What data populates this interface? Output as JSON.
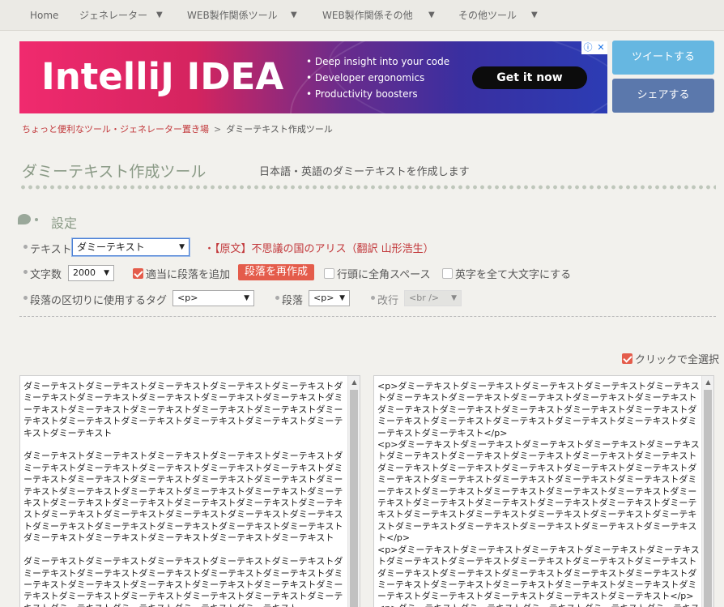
{
  "nav": {
    "items": [
      {
        "label": "Home"
      },
      {
        "label": "ジェネレーター",
        "arrow": "▼"
      },
      {
        "label": "WEB製作関係ツール",
        "arrow": "▼"
      },
      {
        "label": "WEB製作関係その他",
        "arrow": "▼"
      },
      {
        "label": "その他ツール",
        "arrow": "▼"
      }
    ]
  },
  "ad": {
    "logo": "IntelliJ IDEA",
    "bullets": [
      "• Deep insight into your code",
      "• Developer ergonomics",
      "• Productivity boosters"
    ],
    "cta": "Get it now",
    "info_icon": "ⓘ",
    "close_icon": "✕"
  },
  "social": {
    "tweet": "ツイートする",
    "share": "シェアする"
  },
  "breadcrumb": {
    "home": "ちょっと便利なツール・ジェネレーター置き場",
    "sep": ">",
    "current": "ダミーテキスト作成ツール"
  },
  "page": {
    "title": "ダミーテキスト作成ツール",
    "subtitle": "日本語・英語のダミーテキストを作成します"
  },
  "settings": {
    "title": "設定",
    "text_label": "テキスト",
    "text_select": "ダミーテキスト",
    "source_link": "・【原文】不思議の国のアリス（翻訳 山形浩生）",
    "count_label": "文字数",
    "count_select": "2000",
    "para_label": "適当に段落を追加",
    "regen_button": "段落を再作成",
    "indent_label": "行頭に全角スペース",
    "upper_label": "英字を全て大文字にする",
    "sep_tag_label": "段落の区切りに使用するタグ",
    "sep_tag_select": "<p>",
    "paragraph_label": "段落",
    "paragraph_select": "<p>",
    "linebreak_label": "改行",
    "linebreak_select": "<br />",
    "dropdown_arrow": "▼"
  },
  "output": {
    "select_all_label": "クリックで全選択",
    "left_text": "ダミーテキストダミーテキストダミーテキストダミーテキストダミーテキストダミーテキストダミーテキストダミーテキストダミーテキストダミーテキストダミーテキストダミーテキストダミーテキストダミーテキストダミーテキストダミーテキストダミーテキストダミーテキストダミーテキストダミーテキストダミーテキストダミーテキスト\n\nダミーテキストダミーテキストダミーテキストダミーテキストダミーテキストダミーテキストダミーテキストダミーテキストダミーテキストダミーテキストダミーテキストダミーテキストダミーテキストダミーテキストダミーテキストダミーテキストダミーテキストダミーテキストダミーテキストダミーテキストダミーテキストダミーテキストダミーテキストダミーテキストダミーテキストダミーテキストダミーテキストダミーテキストダミーテキストダミーテキストダミーテキストダミーテキストダミーテキストダミーテキストダミーテキストダミーテキストダミーテキストダミーテキストダミーテキストダミーテキストダミーテキスト\n\nダミーテキストダミーテキストダミーテキストダミーテキストダミーテキストダミーテキストダミーテキストダミーテキストダミーテキストダミーテキストダミーテキストダミーテキストダミーテキストダミーテキストダミーテキストダミーテキストダミーテキストダミーテキストダミーテキストダミーテキストダミーテキストダミーテキストダミーテキストダミーテキストダミーテキスト",
    "right_text": "<p>ダミーテキストダミーテキストダミーテキストダミーテキストダミーテキストダミーテキストダミーテキストダミーテキストダミーテキストダミーテキストダミーテキストダミーテキストダミーテキストダミーテキストダミーテキストダミーテキストダミーテキストダミーテキストダミーテキストダミーテキストダミーテキストダミーテキスト</p>\n<p>ダミーテキストダミーテキストダミーテキストダミーテキストダミーテキストダミーテキストダミーテキストダミーテキストダミーテキストダミーテキストダミーテキストダミーテキストダミーテキストダミーテキストダミーテキストダミーテキストダミーテキストダミーテキストダミーテキストダミーテキストダミーテキストダミーテキストダミーテキストダミーテキストダミーテキストダミーテキストダミーテキストダミーテキストダミーテキストダミーテキストダミーテキストダミーテキストダミーテキストダミーテキストダミーテキストダミーテキストダミーテキストダミーテキストダミーテキストダミーテキストダミーテキスト</p>\n<p>ダミーテキストダミーテキストダミーテキストダミーテキストダミーテキストダミーテキストダミーテキストダミーテキストダミーテキストダミーテキストダミーテキストダミーテキストダミーテキストダミーテキストダミーテキストダミーテキストダミーテキストダミーテキストダミーテキストダミーテキストダミーテキストダミーテキストダミーテキストダミーテキストダミーテキスト</p>\n<p>ダミーテキストダミーテキストダミーテキストダミーテキストダミーテキストダミーテキスト",
    "scroll_up": "▲"
  }
}
